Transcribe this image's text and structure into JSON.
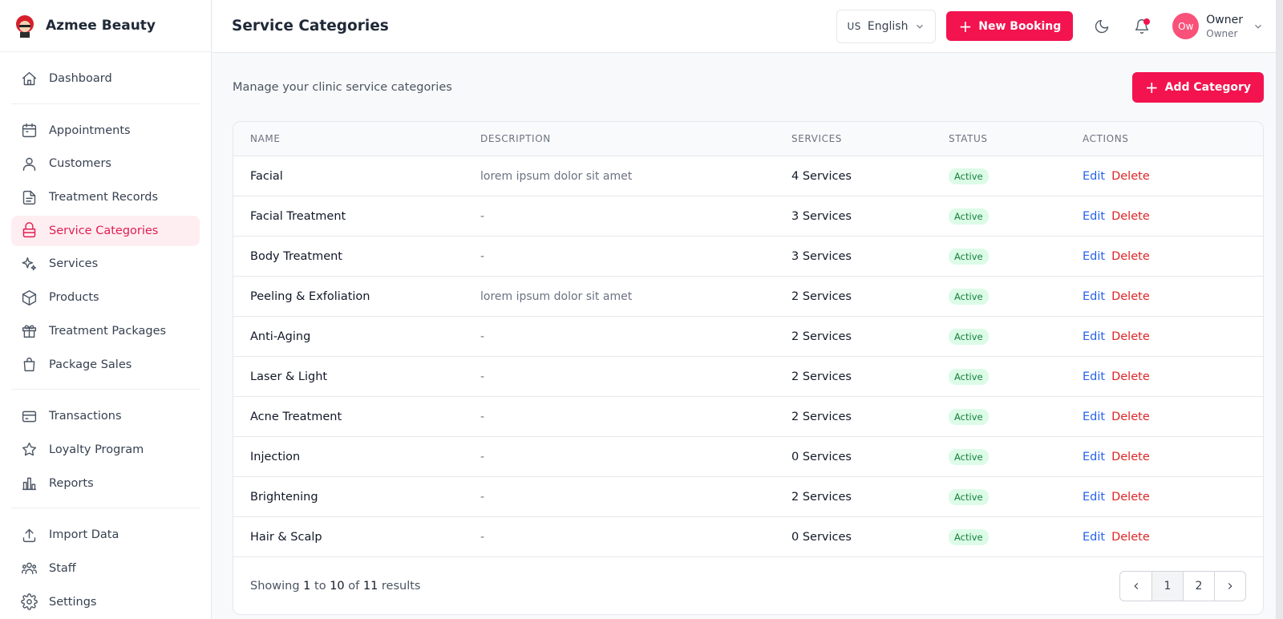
{
  "brand": {
    "name": "Azmee Beauty",
    "logo": "brand-avatar-logo"
  },
  "sidebar": {
    "groups": [
      [
        {
          "label": "Dashboard",
          "icon": "home-icon"
        }
      ],
      [
        {
          "label": "Appointments",
          "icon": "calendar-icon"
        },
        {
          "label": "Customers",
          "icon": "users-icon"
        },
        {
          "label": "Treatment Records",
          "icon": "file-icon"
        },
        {
          "label": "Service Categories",
          "icon": "tray-icon",
          "active": true
        },
        {
          "label": "Services",
          "icon": "sparkles-icon"
        },
        {
          "label": "Products",
          "icon": "box-icon"
        },
        {
          "label": "Treatment Packages",
          "icon": "gift-icon"
        },
        {
          "label": "Package Sales",
          "icon": "bag-icon"
        }
      ],
      [
        {
          "label": "Transactions",
          "icon": "card-icon"
        },
        {
          "label": "Loyalty Program",
          "icon": "star-icon"
        },
        {
          "label": "Reports",
          "icon": "chart-icon"
        }
      ],
      [
        {
          "label": "Import Data",
          "icon": "upload-icon"
        },
        {
          "label": "Staff",
          "icon": "team-icon"
        },
        {
          "label": "Settings",
          "icon": "gear-icon"
        }
      ]
    ]
  },
  "header": {
    "title": "Service Categories",
    "language": {
      "flag": "US",
      "label": "English"
    },
    "new_booking": "New Booking",
    "user": {
      "initials": "Ow",
      "name": "Owner",
      "role": "Owner"
    }
  },
  "main": {
    "subtitle": "Manage your clinic service categories",
    "add_button": "Add Category",
    "columns": [
      "NAME",
      "DESCRIPTION",
      "SERVICES",
      "STATUS",
      "ACTIONS"
    ],
    "rows": [
      {
        "name": "Facial",
        "description": "lorem ipsum dolor sit amet",
        "services": "4 Services",
        "status": "Active"
      },
      {
        "name": "Facial Treatment",
        "description": "-",
        "services": "3 Services",
        "status": "Active"
      },
      {
        "name": "Body Treatment",
        "description": "-",
        "services": "3 Services",
        "status": "Active"
      },
      {
        "name": "Peeling & Exfoliation",
        "description": "lorem ipsum dolor sit amet",
        "services": "2 Services",
        "status": "Active"
      },
      {
        "name": "Anti-Aging",
        "description": "-",
        "services": "2 Services",
        "status": "Active"
      },
      {
        "name": "Laser & Light",
        "description": "-",
        "services": "2 Services",
        "status": "Active"
      },
      {
        "name": "Acne Treatment",
        "description": "-",
        "services": "2 Services",
        "status": "Active"
      },
      {
        "name": "Injection",
        "description": "-",
        "services": "0 Services",
        "status": "Active"
      },
      {
        "name": "Brightening",
        "description": "-",
        "services": "2 Services",
        "status": "Active"
      },
      {
        "name": "Hair & Scalp",
        "description": "-",
        "services": "0 Services",
        "status": "Active"
      }
    ],
    "actions": {
      "edit": "Edit",
      "delete": "Delete"
    },
    "pagination": {
      "showing_prefix": "Showing",
      "from": "1",
      "to_word": "to",
      "to": "10",
      "of_word": "of",
      "total": "11",
      "results_word": "results",
      "pages": [
        "1",
        "2"
      ],
      "current": "1"
    }
  },
  "colors": {
    "accent": "#f2134f",
    "active_bg": "#ffeef1",
    "badge_bg": "#dcfce7",
    "badge_text": "#15803d",
    "edit": "#2563eb",
    "delete": "#dc2626"
  }
}
